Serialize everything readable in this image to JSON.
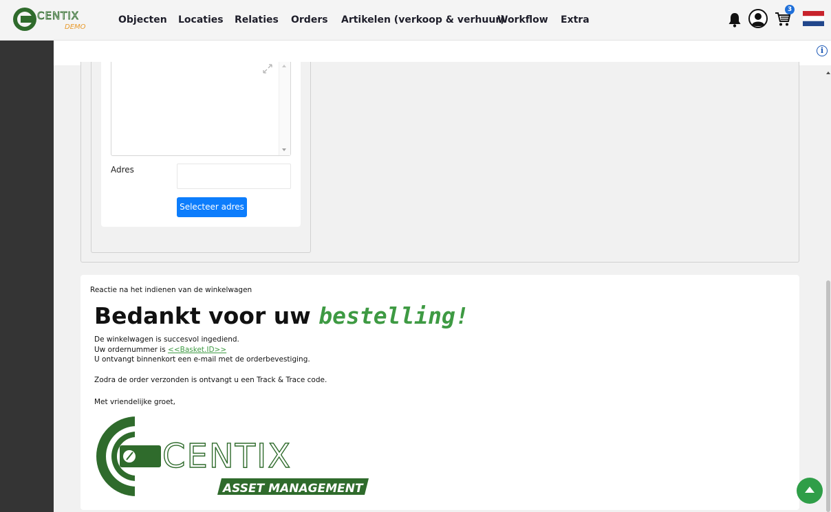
{
  "nav": {
    "logo_text": "CENTIX",
    "logo_subtext": "DEMO",
    "items": [
      {
        "label": "Objecten"
      },
      {
        "label": "Locaties"
      },
      {
        "label": "Relaties"
      },
      {
        "label": "Orders"
      },
      {
        "label": "Artikelen (verkoop & verhuur)"
      },
      {
        "label": "Workflow"
      },
      {
        "label": "Extra"
      }
    ],
    "cart_count": "3",
    "icons": [
      "bell-icon",
      "user-icon",
      "cart-icon",
      "flag-nl-icon"
    ]
  },
  "infobar": {
    "icon": "info-icon",
    "icon_glyph": "i"
  },
  "form": {
    "adres_label": "Adres",
    "adres_value": "",
    "select_button": "Selecteer adres"
  },
  "reaction": {
    "section_label": "Reactie na het indienen van de winkelwagen",
    "heading_main": "Bedankt voor uw ",
    "heading_emphasis": "bestelling!",
    "line1": "De winkelwagen is succesvol ingediend.",
    "line2_prefix": "Uw ordernummer is ",
    "line2_link": "<<Basket.ID>>",
    "line3": "U ontvangt binnenkort een e-mail met de orderbevestiging.",
    "line4": "Zodra de order verzonden is ontvangt u een Track & Trace code.",
    "line5": "Met vriendelijke groet,",
    "logo_text": "CENTIX",
    "logo_tagline": "ASSET MANAGEMENT"
  },
  "colors": {
    "brand_green": "#3e9a43",
    "dark_green": "#2f6b2c",
    "primary_button": "#0d7dfc",
    "sidebar": "#343434"
  }
}
